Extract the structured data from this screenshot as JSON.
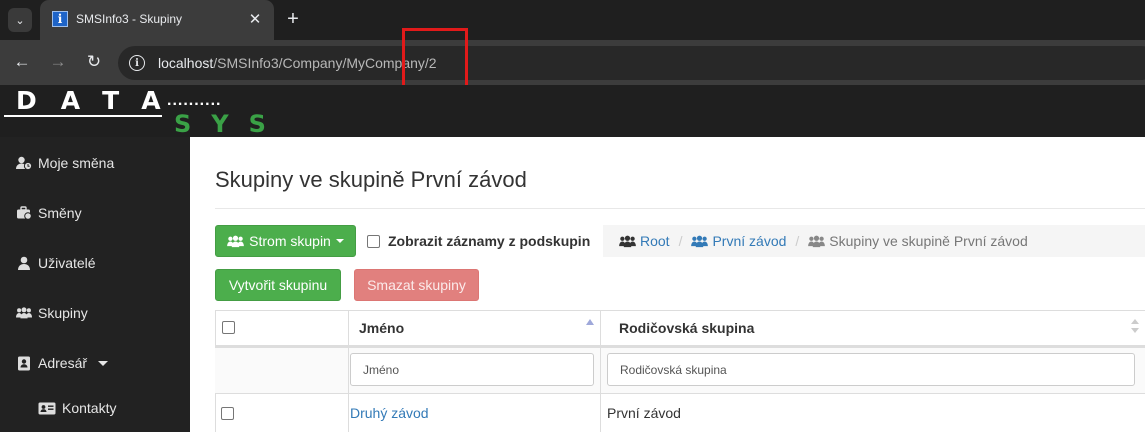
{
  "browser": {
    "tab_title": "SMSInfo3 - Skupiny",
    "url_host": "localhost",
    "url_path": "/SMSInfo3/Company/MyCompany/2"
  },
  "logo": {
    "word_top": "DATA",
    "dots": "..........",
    "word_bottom": "SYS"
  },
  "sidebar": {
    "items": [
      {
        "label": "Moje směna",
        "icon": "user-clock-icon"
      },
      {
        "label": "Směny",
        "icon": "briefcase-icon"
      },
      {
        "label": "Uživatelé",
        "icon": "user-icon"
      },
      {
        "label": "Skupiny",
        "icon": "users-icon"
      },
      {
        "label": "Adresář",
        "icon": "address-book-icon"
      },
      {
        "label": "Kontakty",
        "icon": "id-card-icon"
      }
    ]
  },
  "main": {
    "title": "Skupiny ve skupině První závod",
    "tree_button": "Strom skupin",
    "show_sub_label": "Zobrazit záznamy z podskupin",
    "breadcrumb": {
      "root": "Root",
      "parent": "První závod",
      "current": "Skupiny ve skupině První závod"
    },
    "create_button": "Vytvořit skupinu",
    "delete_button": "Smazat skupiny"
  },
  "table": {
    "columns": [
      "Jméno",
      "Rodičovská skupina"
    ],
    "filter_placeholders": [
      "Jméno",
      "Rodičovská skupina"
    ],
    "rows": [
      {
        "name": "Druhý závod",
        "parent": "První závod"
      }
    ]
  },
  "colors": {
    "brand_green": "#3aa146",
    "button_green": "#4cae4c",
    "button_red": "#e1807e",
    "link_blue": "#337ab7",
    "highlight_red": "#e11a1a"
  }
}
